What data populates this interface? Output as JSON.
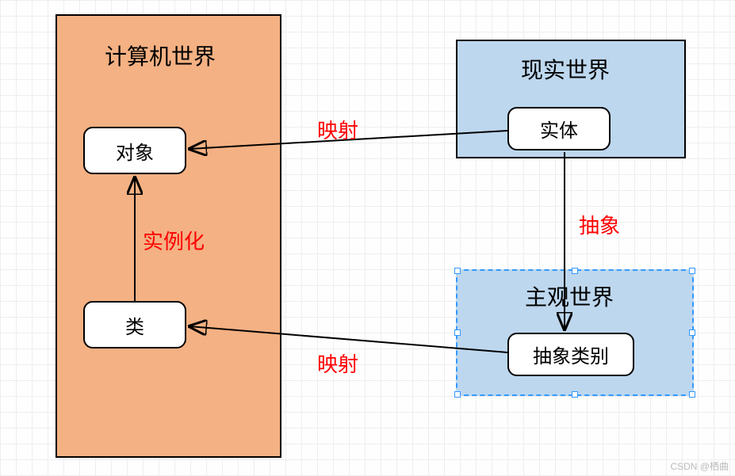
{
  "boxes": {
    "computer": {
      "title": "计算机世界"
    },
    "real": {
      "title": "现实世界"
    },
    "subjective": {
      "title": "主观世界"
    }
  },
  "nodes": {
    "object": "对象",
    "class": "类",
    "entity": "实体",
    "abstractCategory": "抽象类别"
  },
  "edges": {
    "instantiate": "实例化",
    "map1": "映射",
    "map2": "映射",
    "abstract": "抽象"
  },
  "watermark": "CSDN @栖曲"
}
